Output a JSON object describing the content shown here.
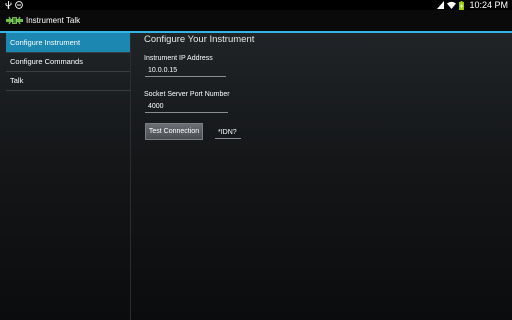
{
  "status_bar": {
    "time": "10:24 PM"
  },
  "action_bar": {
    "title": "Instrument Talk"
  },
  "sidebar": {
    "items": [
      {
        "label": "Configure Instrument",
        "active": true
      },
      {
        "label": "Configure Commands",
        "active": false
      },
      {
        "label": "Talk",
        "active": false
      }
    ]
  },
  "content": {
    "heading": "Configure Your Instrument",
    "ip_label": "Instrument IP Address",
    "ip_value": "10.0.0.15",
    "port_label": "Socket Server Port Number",
    "port_value": "4000",
    "test_button": "Test Connection",
    "command_value": "*IDN?"
  },
  "colors": {
    "accent": "#33b5e5",
    "selected": "#1c87b0",
    "battery": "#99cc00"
  },
  "icons": [
    "usb-debug-icon",
    "do-not-disturb-icon",
    "signal-icon",
    "wifi-icon",
    "battery-charging-icon",
    "app-logo-icon"
  ]
}
